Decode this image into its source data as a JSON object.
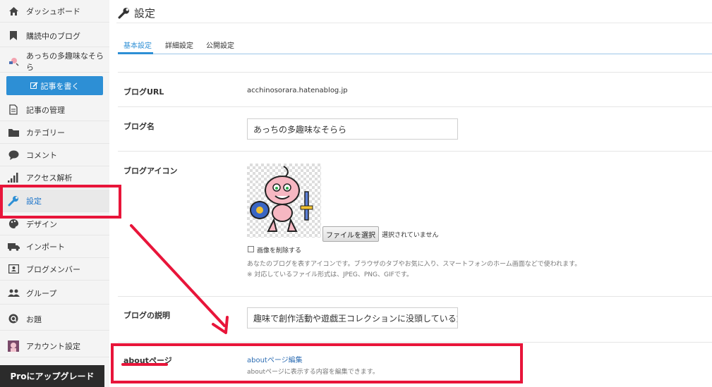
{
  "sidebar": {
    "items": [
      {
        "label": "ダッシュボード",
        "icon": "home-icon"
      },
      {
        "label": "購読中のブログ",
        "icon": "bookmark-icon"
      },
      {
        "label": "あっちの多趣味なそらら",
        "icon": "blog-avatar-icon"
      },
      {
        "label": "記事の管理",
        "icon": "document-icon"
      },
      {
        "label": "カテゴリー",
        "icon": "folder-icon"
      },
      {
        "label": "コメント",
        "icon": "comment-icon"
      },
      {
        "label": "アクセス解析",
        "icon": "bar-chart-icon"
      },
      {
        "label": "設定",
        "icon": "wrench-icon"
      },
      {
        "label": "デザイン",
        "icon": "palette-icon"
      },
      {
        "label": "インポート",
        "icon": "truck-icon"
      },
      {
        "label": "ブログメンバー",
        "icon": "id-card-icon"
      },
      {
        "label": "グループ",
        "icon": "group-icon"
      },
      {
        "label": "お題",
        "icon": "search-icon"
      },
      {
        "label": "アカウント設定",
        "icon": "user-avatar-icon"
      }
    ],
    "write_button": "記事を書く",
    "upgrade_button": "Proにアップグレード"
  },
  "header": {
    "title": "設定"
  },
  "tabs": [
    {
      "label": "基本設定",
      "active": true
    },
    {
      "label": "詳細設定",
      "active": false
    },
    {
      "label": "公開設定",
      "active": false
    }
  ],
  "settings": {
    "blog_url": {
      "label": "ブログURL",
      "value": "acchinosorara.hatenablog.jp"
    },
    "blog_name": {
      "label": "ブログ名",
      "value": "あっちの多趣味なそらら"
    },
    "blog_icon": {
      "label": "ブログアイコン",
      "file_button": "ファイルを選択",
      "file_status": "選択されていません",
      "delete_label": "画像を削除する",
      "note1": "あなたのブログを表すアイコンです。ブラウザのタブやお気に入り、スマートフォンのホーム画面などで使われます。",
      "note2": "※ 対応しているファイル形式は、JPEG、PNG、GIFです。"
    },
    "blog_description": {
      "label": "ブログの説明",
      "value": "趣味で創作活動や遊戯王コレクションに没頭している方"
    },
    "about_page": {
      "label": "aboutページ",
      "link": "aboutページ編集",
      "note": "aboutページに表示する内容を編集できます。"
    }
  },
  "colors": {
    "accent": "#2d8fd5",
    "annotation": "#e8153a",
    "upgrade_bg": "#2b2b2b"
  }
}
